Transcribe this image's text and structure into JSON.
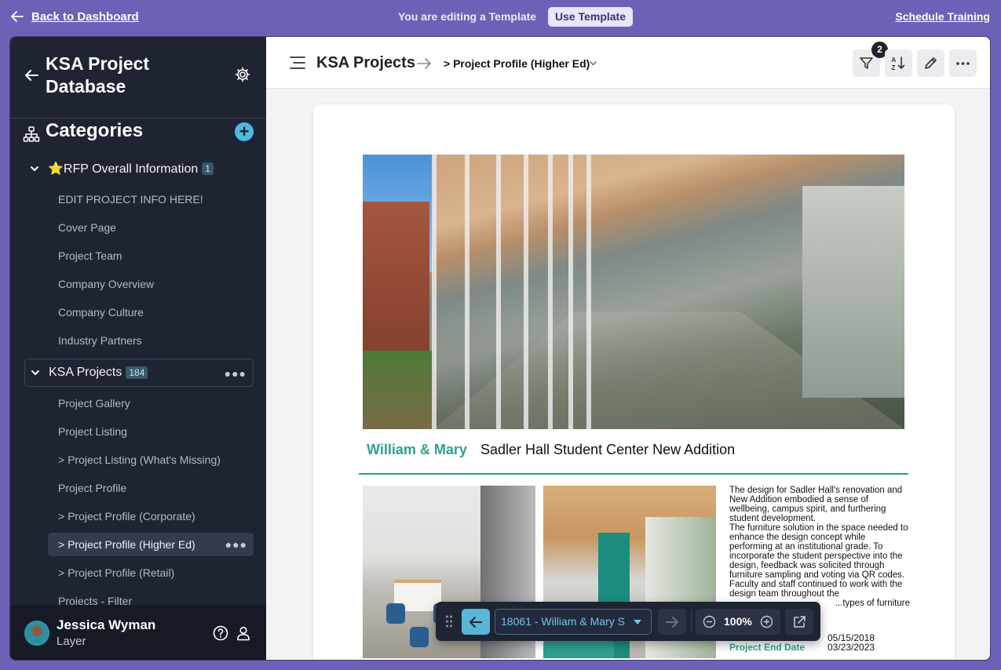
{
  "topbar": {
    "back_label": "Back to Dashboard",
    "editing_notice": "You are editing a Template",
    "use_template_label": "Use Template",
    "schedule_label": "Schedule Training"
  },
  "sidebar": {
    "title": "KSA Project Database",
    "categories_label": "Categories",
    "sections": [
      {
        "label": "⭐RFP Overall Information",
        "count": "1",
        "items": [
          "EDIT PROJECT INFO HERE!",
          "Cover Page",
          "Project Team",
          "Company Overview",
          "Company Culture",
          "Industry Partners"
        ]
      },
      {
        "label": "KSA Projects",
        "count": "184",
        "items": [
          "Project Gallery",
          "Project Listing",
          "> Project Listing (What's Missing)",
          "Project Profile",
          "> Project Profile (Corporate)",
          "> Project Profile (Higher Ed)",
          "> Project Profile (Retail)",
          "Projects - Filter"
        ]
      }
    ],
    "active_item": "> Project Profile (Higher Ed)",
    "user": {
      "name": "Jessica Wyman",
      "org": "Layer"
    }
  },
  "header": {
    "title": "KSA Projects",
    "view_name": "> Project Profile (Higher Ed)",
    "filter_count": "2"
  },
  "page": {
    "school": "William & Mary",
    "project_name": "Sadler Hall Student Center New Addition",
    "description_1": "The design for Sadler Hall's renovation and New Addition embodied a sense of wellbeing, campus spirit, and furthering student development.",
    "description_2": "The furniture solution in the space needed to enhance the design concept while performing at an institutional grade. To incorporate the student perspective into the design, feedback was solicited through furniture sampling and voting via QR codes. Faculty and staff continued to work with the design team throughout the",
    "description_3": "...types of furniture",
    "start_date": "05/15/2018",
    "end_label": "Project End Date",
    "end_date": "03/23/2023"
  },
  "navigator": {
    "record": "18061 - William & Mary S",
    "zoom": "100%"
  },
  "colors": {
    "accent_teal": "#2aa58c",
    "brand_purple": "#6b62b8",
    "sidebar_bg": "#1f2433",
    "nav_blue": "#5ab6d8"
  },
  "icons": [
    "arrow-left-icon",
    "gear-icon",
    "hierarchy-icon",
    "plus-icon",
    "chevron-down-icon",
    "more-icon",
    "help-icon",
    "person-icon",
    "menu-icon",
    "arrow-right-icon",
    "filter-icon",
    "sort-az-icon",
    "pencil-icon",
    "grip-icon",
    "zoom-out-icon",
    "zoom-in-icon",
    "open-external-icon"
  ]
}
